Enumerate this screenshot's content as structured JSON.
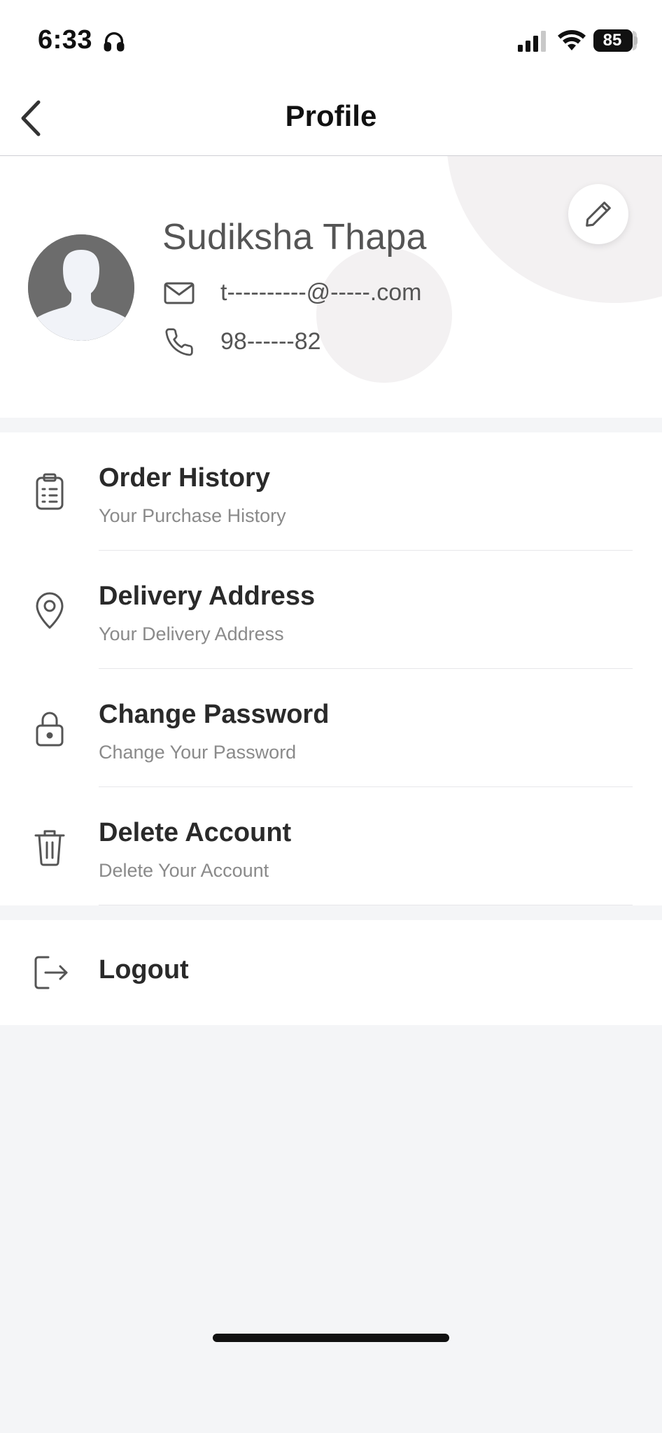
{
  "status_bar": {
    "time": "6:33",
    "battery": "85",
    "icons": [
      "headphones-icon",
      "cellular-signal-icon",
      "wifi-icon",
      "battery-icon"
    ]
  },
  "header": {
    "title": "Profile",
    "back_icon": "chevron-left-icon"
  },
  "profile": {
    "name": "Sudiksha Thapa",
    "email": "t----------@-----.com",
    "phone": "98------82",
    "edit_icon": "pencil-icon",
    "email_icon": "mail-icon",
    "phone_icon": "phone-icon"
  },
  "menu": {
    "items": [
      {
        "title": "Order History",
        "subtitle": "Your Purchase History",
        "icon": "clipboard-list-icon"
      },
      {
        "title": "Delivery Address",
        "subtitle": "Your Delivery Address",
        "icon": "location-pin-icon"
      },
      {
        "title": "Change Password",
        "subtitle": "Change Your Password",
        "icon": "lock-icon"
      },
      {
        "title": "Delete Account",
        "subtitle": "Delete Your Account",
        "icon": "trash-icon"
      }
    ],
    "logout": {
      "title": "Logout",
      "icon": "logout-icon"
    }
  },
  "colors": {
    "background": "#f4f5f7",
    "card": "#ffffff",
    "title_text": "#2a2a2a",
    "subtitle_text": "#8a8a8a",
    "avatar": "#6c6c6c",
    "decor_circle": "#f3f1f2"
  }
}
